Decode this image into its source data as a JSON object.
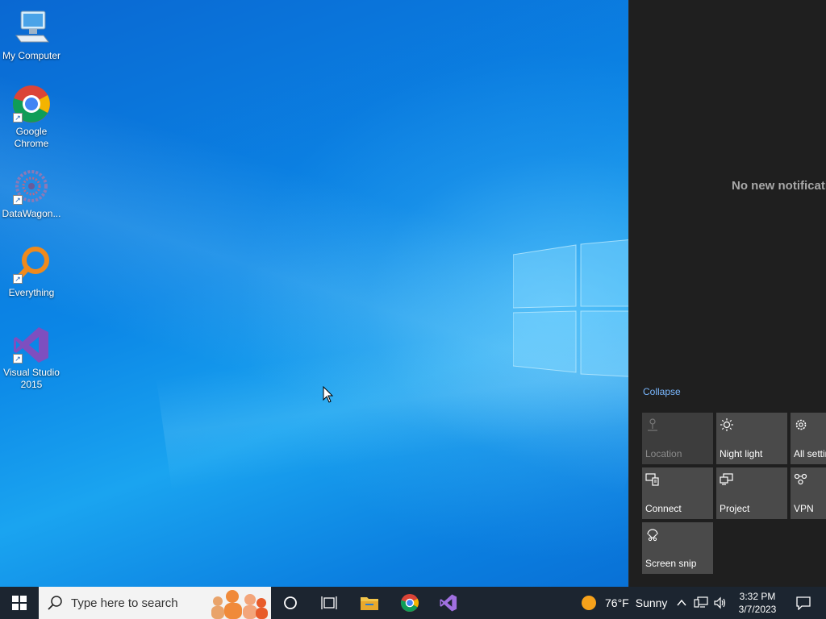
{
  "desktop": {
    "icons": [
      {
        "label": "My Computer"
      },
      {
        "label": "Google Chrome"
      },
      {
        "label": "DataWagon..."
      },
      {
        "label": "Everything"
      },
      {
        "label": "Visual Studio 2015"
      }
    ]
  },
  "action_center": {
    "empty_message": "No new notifications",
    "collapse_label": "Collapse",
    "tiles": [
      {
        "label": "Location",
        "icon": "location-icon",
        "state": "disabled"
      },
      {
        "label": "Night light",
        "icon": "brightness-icon"
      },
      {
        "label": "All settings",
        "icon": "gear-icon"
      },
      {
        "label": "Connect",
        "icon": "connect-icon"
      },
      {
        "label": "Project",
        "icon": "project-icon"
      },
      {
        "label": "VPN",
        "icon": "vpn-icon"
      },
      {
        "label": "Screen snip",
        "icon": "screen-snip-icon"
      }
    ]
  },
  "taskbar": {
    "search_placeholder": "Type here to search",
    "weather": {
      "temp": "76°F",
      "condition": "Sunny"
    },
    "clock": {
      "time": "3:32 PM",
      "date": "3/7/2023"
    }
  },
  "colors": {
    "accent": "#0a78d7",
    "action_center_bg": "#1f1f1f",
    "tile_bg": "#4a4a4a",
    "link": "#7ab8ff",
    "taskbar_bg": "#1c2530"
  }
}
